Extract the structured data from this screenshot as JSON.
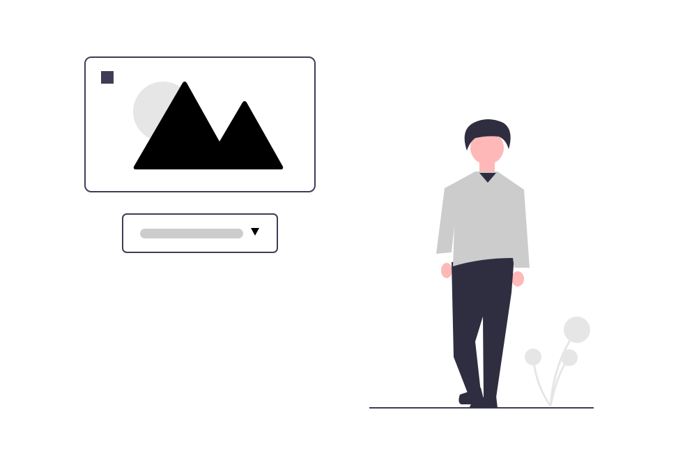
{
  "illustration": {
    "image_placeholder": {
      "icon": "image-icon",
      "colors": {
        "border": "#3f3d56",
        "square": "#3f3d56",
        "sun": "#e6e6e6",
        "mountains": "#000000"
      }
    },
    "dropdown": {
      "icon": "caret-down-icon",
      "placeholder_color": "#cccccc"
    },
    "person": {
      "colors": {
        "hair": "#2f2e41",
        "skin": "#ffb8b8",
        "shirt": "#cccccc",
        "pants": "#2f2e41",
        "shoes": "#2f2e41"
      }
    },
    "plant": {
      "color": "#e6e6e6"
    },
    "ground_color": "#3f3d56"
  }
}
